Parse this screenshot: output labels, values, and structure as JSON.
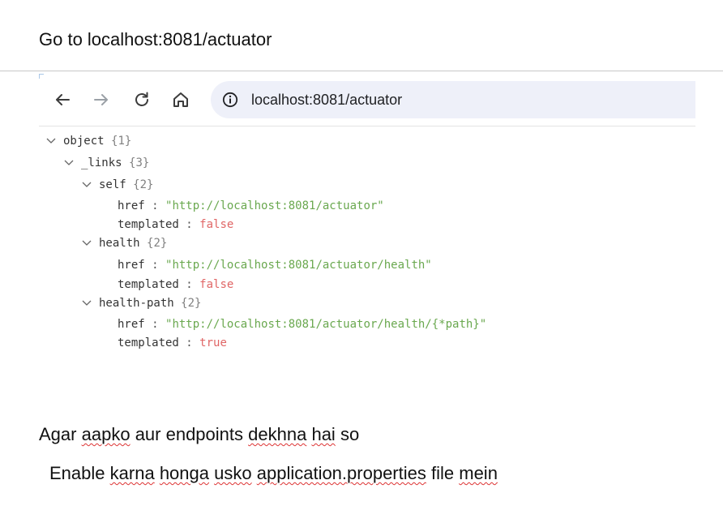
{
  "heading": "Go to localhost:8081/actuator",
  "browser": {
    "url": "localhost:8081/actuator"
  },
  "json_tree": {
    "root_key": "object",
    "root_count": "{1}",
    "links_key": "_links",
    "links_count": "{3}",
    "groups": [
      {
        "key": "self",
        "count": "{2}",
        "href_label": "href",
        "href_value": "\"http://localhost:8081/actuator\"",
        "templated_label": "templated",
        "templated_value": "false"
      },
      {
        "key": "health",
        "count": "{2}",
        "href_label": "href",
        "href_value": "\"http://localhost:8081/actuator/health\"",
        "templated_label": "templated",
        "templated_value": "false"
      },
      {
        "key": "health-path",
        "count": "{2}",
        "href_label": "href",
        "href_value": "\"http://localhost:8081/actuator/health/{*path}\"",
        "templated_label": "templated",
        "templated_value": "true"
      }
    ]
  },
  "notes": {
    "line1": {
      "w1": "Agar",
      "w2": "aapko",
      "w3": "aur endpoints",
      "w4": "dekhna",
      "w5": "hai",
      "w6": "so"
    },
    "line2": {
      "w1": "Enable",
      "w2": "karna",
      "w3": "honga",
      "w4": "usko",
      "w5": "application.properties",
      "w6": "file",
      "w7": "mein"
    }
  }
}
